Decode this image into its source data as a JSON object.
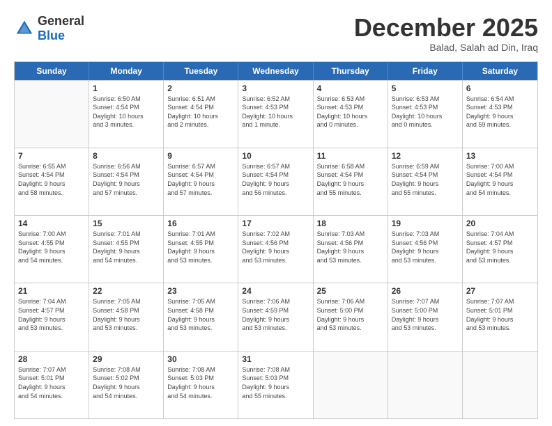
{
  "header": {
    "logo_general": "General",
    "logo_blue": "Blue",
    "month": "December 2025",
    "location": "Balad, Salah ad Din, Iraq"
  },
  "weekdays": [
    "Sunday",
    "Monday",
    "Tuesday",
    "Wednesday",
    "Thursday",
    "Friday",
    "Saturday"
  ],
  "weeks": [
    [
      {
        "day": "",
        "lines": []
      },
      {
        "day": "1",
        "lines": [
          "Sunrise: 6:50 AM",
          "Sunset: 4:54 PM",
          "Daylight: 10 hours",
          "and 3 minutes."
        ]
      },
      {
        "day": "2",
        "lines": [
          "Sunrise: 6:51 AM",
          "Sunset: 4:54 PM",
          "Daylight: 10 hours",
          "and 2 minutes."
        ]
      },
      {
        "day": "3",
        "lines": [
          "Sunrise: 6:52 AM",
          "Sunset: 4:53 PM",
          "Daylight: 10 hours",
          "and 1 minute."
        ]
      },
      {
        "day": "4",
        "lines": [
          "Sunrise: 6:53 AM",
          "Sunset: 4:53 PM",
          "Daylight: 10 hours",
          "and 0 minutes."
        ]
      },
      {
        "day": "5",
        "lines": [
          "Sunrise: 6:53 AM",
          "Sunset: 4:53 PM",
          "Daylight: 10 hours",
          "and 0 minutes."
        ]
      },
      {
        "day": "6",
        "lines": [
          "Sunrise: 6:54 AM",
          "Sunset: 4:53 PM",
          "Daylight: 9 hours",
          "and 59 minutes."
        ]
      }
    ],
    [
      {
        "day": "7",
        "lines": [
          "Sunrise: 6:55 AM",
          "Sunset: 4:54 PM",
          "Daylight: 9 hours",
          "and 58 minutes."
        ]
      },
      {
        "day": "8",
        "lines": [
          "Sunrise: 6:56 AM",
          "Sunset: 4:54 PM",
          "Daylight: 9 hours",
          "and 57 minutes."
        ]
      },
      {
        "day": "9",
        "lines": [
          "Sunrise: 6:57 AM",
          "Sunset: 4:54 PM",
          "Daylight: 9 hours",
          "and 57 minutes."
        ]
      },
      {
        "day": "10",
        "lines": [
          "Sunrise: 6:57 AM",
          "Sunset: 4:54 PM",
          "Daylight: 9 hours",
          "and 56 minutes."
        ]
      },
      {
        "day": "11",
        "lines": [
          "Sunrise: 6:58 AM",
          "Sunset: 4:54 PM",
          "Daylight: 9 hours",
          "and 55 minutes."
        ]
      },
      {
        "day": "12",
        "lines": [
          "Sunrise: 6:59 AM",
          "Sunset: 4:54 PM",
          "Daylight: 9 hours",
          "and 55 minutes."
        ]
      },
      {
        "day": "13",
        "lines": [
          "Sunrise: 7:00 AM",
          "Sunset: 4:54 PM",
          "Daylight: 9 hours",
          "and 54 minutes."
        ]
      }
    ],
    [
      {
        "day": "14",
        "lines": [
          "Sunrise: 7:00 AM",
          "Sunset: 4:55 PM",
          "Daylight: 9 hours",
          "and 54 minutes."
        ]
      },
      {
        "day": "15",
        "lines": [
          "Sunrise: 7:01 AM",
          "Sunset: 4:55 PM",
          "Daylight: 9 hours",
          "and 54 minutes."
        ]
      },
      {
        "day": "16",
        "lines": [
          "Sunrise: 7:01 AM",
          "Sunset: 4:55 PM",
          "Daylight: 9 hours",
          "and 53 minutes."
        ]
      },
      {
        "day": "17",
        "lines": [
          "Sunrise: 7:02 AM",
          "Sunset: 4:56 PM",
          "Daylight: 9 hours",
          "and 53 minutes."
        ]
      },
      {
        "day": "18",
        "lines": [
          "Sunrise: 7:03 AM",
          "Sunset: 4:56 PM",
          "Daylight: 9 hours",
          "and 53 minutes."
        ]
      },
      {
        "day": "19",
        "lines": [
          "Sunrise: 7:03 AM",
          "Sunset: 4:56 PM",
          "Daylight: 9 hours",
          "and 53 minutes."
        ]
      },
      {
        "day": "20",
        "lines": [
          "Sunrise: 7:04 AM",
          "Sunset: 4:57 PM",
          "Daylight: 9 hours",
          "and 53 minutes."
        ]
      }
    ],
    [
      {
        "day": "21",
        "lines": [
          "Sunrise: 7:04 AM",
          "Sunset: 4:57 PM",
          "Daylight: 9 hours",
          "and 53 minutes."
        ]
      },
      {
        "day": "22",
        "lines": [
          "Sunrise: 7:05 AM",
          "Sunset: 4:58 PM",
          "Daylight: 9 hours",
          "and 53 minutes."
        ]
      },
      {
        "day": "23",
        "lines": [
          "Sunrise: 7:05 AM",
          "Sunset: 4:58 PM",
          "Daylight: 9 hours",
          "and 53 minutes."
        ]
      },
      {
        "day": "24",
        "lines": [
          "Sunrise: 7:06 AM",
          "Sunset: 4:59 PM",
          "Daylight: 9 hours",
          "and 53 minutes."
        ]
      },
      {
        "day": "25",
        "lines": [
          "Sunrise: 7:06 AM",
          "Sunset: 5:00 PM",
          "Daylight: 9 hours",
          "and 53 minutes."
        ]
      },
      {
        "day": "26",
        "lines": [
          "Sunrise: 7:07 AM",
          "Sunset: 5:00 PM",
          "Daylight: 9 hours",
          "and 53 minutes."
        ]
      },
      {
        "day": "27",
        "lines": [
          "Sunrise: 7:07 AM",
          "Sunset: 5:01 PM",
          "Daylight: 9 hours",
          "and 53 minutes."
        ]
      }
    ],
    [
      {
        "day": "28",
        "lines": [
          "Sunrise: 7:07 AM",
          "Sunset: 5:01 PM",
          "Daylight: 9 hours",
          "and 54 minutes."
        ]
      },
      {
        "day": "29",
        "lines": [
          "Sunrise: 7:08 AM",
          "Sunset: 5:02 PM",
          "Daylight: 9 hours",
          "and 54 minutes."
        ]
      },
      {
        "day": "30",
        "lines": [
          "Sunrise: 7:08 AM",
          "Sunset: 5:03 PM",
          "Daylight: 9 hours",
          "and 54 minutes."
        ]
      },
      {
        "day": "31",
        "lines": [
          "Sunrise: 7:08 AM",
          "Sunset: 5:03 PM",
          "Daylight: 9 hours",
          "and 55 minutes."
        ]
      },
      {
        "day": "",
        "lines": []
      },
      {
        "day": "",
        "lines": []
      },
      {
        "day": "",
        "lines": []
      }
    ]
  ]
}
